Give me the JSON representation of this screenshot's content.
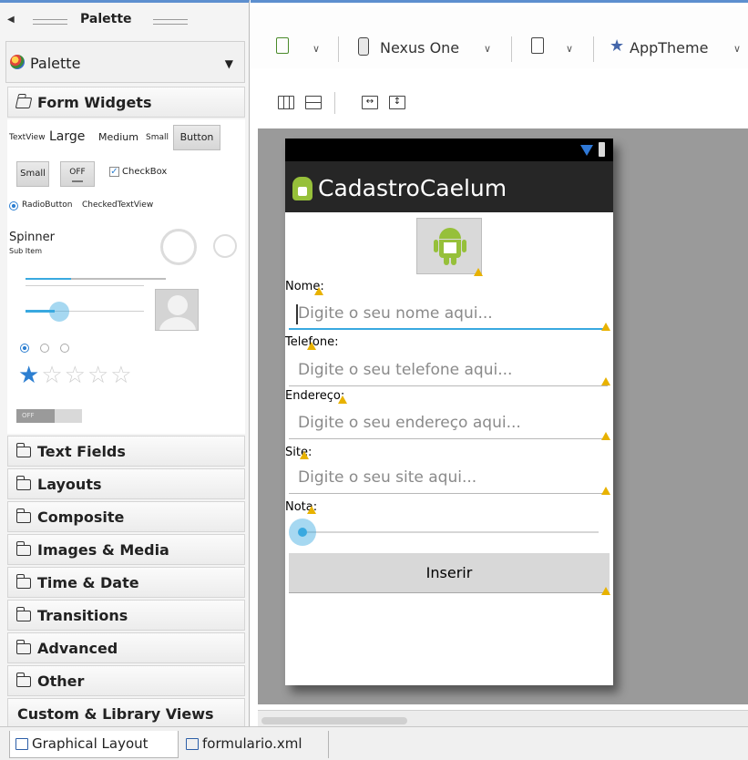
{
  "palette": {
    "header_title": "Palette",
    "dropdown_label": "Palette",
    "open_section": "Form Widgets",
    "widgets": {
      "textview": "TextView",
      "large": "Large",
      "medium": "Medium",
      "small": "Small",
      "button": "Button",
      "small_button": "Small",
      "toggle_off": "OFF",
      "checkbox": "CheckBox",
      "radiobutton": "RadioButton",
      "checkedtextview": "CheckedTextView",
      "spinner": "Spinner",
      "sub_item": "Sub Item",
      "switch_off": "OFF",
      "rating_stars_filled": 1,
      "rating_stars_total": 5
    },
    "sections": [
      "Text Fields",
      "Layouts",
      "Composite",
      "Images & Media",
      "Time & Date",
      "Transitions",
      "Advanced",
      "Other",
      "Custom & Library Views"
    ]
  },
  "toolbar": {
    "device": "Nexus One",
    "theme": "AppTheme"
  },
  "device": {
    "app_title": "CadastroCaelum",
    "fields": [
      {
        "label": "Nome:",
        "placeholder": "Digite o seu nome aqui..."
      },
      {
        "label": "Telefone:",
        "placeholder": "Digite o seu telefone aqui..."
      },
      {
        "label": "Endereço:",
        "placeholder": "Digite o seu endereço aqui..."
      },
      {
        "label": "Site:",
        "placeholder": "Digite o seu site aqui..."
      }
    ],
    "rating_label": "Nota:",
    "seekbar_value": 0,
    "submit_label": "Inserir"
  },
  "tabs": [
    {
      "label": "Graphical Layout",
      "active": true
    },
    {
      "label": "formulario.xml",
      "active": false
    }
  ],
  "colors": {
    "accent": "#39a9e0",
    "action_bar": "#262626",
    "android_green": "#96c03a",
    "warning": "#e8b200"
  }
}
